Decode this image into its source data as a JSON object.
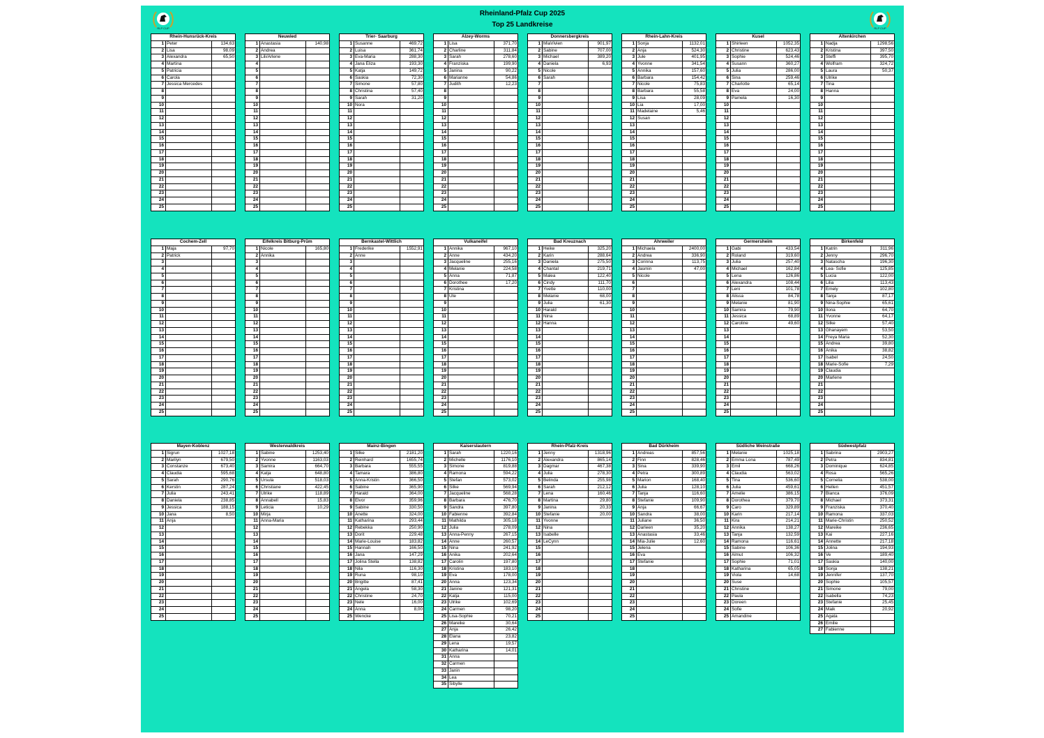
{
  "title": "Rheinland-Pfalz Cup 2025",
  "subtitle": "Top 25 Landkreise",
  "logo_text": "RLP CUP",
  "boards": [
    {
      "name": "Rhein-Hunsrück-Kreis",
      "rows": 25,
      "entries": [
        [
          "Peter",
          "134,63"
        ],
        [
          "Lisa",
          "98,09"
        ],
        [
          "Alexandra",
          "65,50"
        ],
        [
          "Martina",
          ""
        ],
        [
          "Patricia",
          ""
        ],
        [
          "Carola",
          ""
        ],
        [
          "Jessica Mercedes",
          ""
        ]
      ]
    },
    {
      "name": "Neuwied",
      "rows": 25,
      "entries": [
        [
          "Anastasia",
          "140,98"
        ],
        [
          "Andrea",
          ""
        ],
        [
          "Lili/Arlene",
          ""
        ]
      ]
    },
    {
      "name": "Trier- Saarburg",
      "rows": 25,
      "entries": [
        [
          "Susanne",
          "469,72"
        ],
        [
          "Luisa",
          "361,74"
        ],
        [
          "Eva-Maria",
          "288,30"
        ],
        [
          "Jana Eliza",
          "193,30"
        ],
        [
          "Katja",
          "149,72"
        ],
        [
          "Saskia",
          "72,30"
        ],
        [
          "Simone",
          "57,80"
        ],
        [
          "Christina",
          "57,40"
        ],
        [
          "Sarah",
          "31,20"
        ],
        [
          "Nora",
          ""
        ]
      ]
    },
    {
      "name": "Alzey-Worms",
      "rows": 25,
      "entries": [
        [
          "Lisa",
          "371,70"
        ],
        [
          "Charline",
          "311,84"
        ],
        [
          "Sarah",
          "278,60"
        ],
        [
          "Franziska",
          "199,90"
        ],
        [
          "Janina",
          "90,22"
        ],
        [
          "Marianne",
          "54,86"
        ],
        [
          "Judith",
          "12,23"
        ]
      ]
    },
    {
      "name": "Donnersbergkreis",
      "rows": 25,
      "entries": [
        [
          "MiaVivien",
          "901,97"
        ],
        [
          "Sabine",
          "707,00"
        ],
        [
          "Michael",
          "389,20"
        ],
        [
          "Daniela",
          "6,93"
        ],
        [
          "Nicole",
          ""
        ],
        [
          "Sarah",
          ""
        ]
      ]
    },
    {
      "name": "Rhein-Lahn-Kreis",
      "rows": 25,
      "entries": [
        [
          "Sonja",
          "1132,01"
        ],
        [
          "Anja",
          "524,30"
        ],
        [
          "Jule",
          "401,95"
        ],
        [
          "Yvonne",
          "341,54"
        ],
        [
          "Annika",
          "157,60"
        ],
        [
          "Barbara",
          "154,42"
        ],
        [
          "Nicole",
          "75,83"
        ],
        [
          "Barbara",
          "55,58"
        ],
        [
          "Lisa",
          "28,09"
        ],
        [
          "Lia",
          "17,00"
        ],
        [
          "Madelaine",
          "5,46"
        ],
        [
          "Susan",
          ""
        ]
      ]
    },
    {
      "name": "Kusel",
      "rows": 25,
      "entries": [
        [
          "Shirleen",
          "1052,35"
        ],
        [
          "Christine",
          "623,43"
        ],
        [
          "Sophie",
          "524,46"
        ],
        [
          "Susann",
          "360,27"
        ],
        [
          "Julia",
          "286,00"
        ],
        [
          "Sina",
          "259,46"
        ],
        [
          "Charlotte",
          "65,14"
        ],
        [
          "Eva",
          "24,00"
        ],
        [
          "Pamela",
          "16,30"
        ]
      ]
    },
    {
      "name": "Altenkirchen",
      "rows": 25,
      "entries": [
        [
          "Nadja",
          "1298,56"
        ],
        [
          "Kristina",
          "397,50"
        ],
        [
          "Steffi",
          "395,70"
        ],
        [
          "Wolfram",
          "324,72"
        ],
        [
          "Laura",
          "50,37"
        ],
        [
          "Ulrike",
          ""
        ],
        [
          "Tina",
          ""
        ],
        [
          "Hanna",
          ""
        ]
      ]
    },
    {
      "name": "Cochem-Zell",
      "rows": 25,
      "entries": [
        [
          "Maja",
          "97,70"
        ],
        [
          "Patrick",
          ""
        ]
      ]
    },
    {
      "name": "Eifelkreis Bitburg-Prüm",
      "rows": 25,
      "entries": [
        [
          "Nicole",
          "165,80"
        ],
        [
          "Annika",
          ""
        ]
      ]
    },
    {
      "name": "Bernkastel-Wittlich",
      "rows": 25,
      "entries": [
        [
          "Frederike",
          "1552,91"
        ],
        [
          "Anne",
          ""
        ]
      ]
    },
    {
      "name": "Vulkaneifel",
      "rows": 25,
      "entries": [
        [
          "Annika",
          "967,10"
        ],
        [
          "Anne",
          "434,20"
        ],
        [
          "Jacqueline",
          "255,16"
        ],
        [
          "Melanie",
          "224,58"
        ],
        [
          "Anna",
          "71,87"
        ],
        [
          "Dorothee",
          "17,20"
        ],
        [
          "Kristina",
          ""
        ],
        [
          "Ute",
          ""
        ]
      ]
    },
    {
      "name": "Bad Kreuznach",
      "rows": 25,
      "entries": [
        [
          "Heike",
          "325,20"
        ],
        [
          "Karin",
          "288,64"
        ],
        [
          "Daniela",
          "275,50"
        ],
        [
          "Chantal",
          "219,71"
        ],
        [
          "Malea",
          "122,40"
        ],
        [
          "Cindy",
          "111,70"
        ],
        [
          "Yvette",
          "110,00"
        ],
        [
          "Melanie",
          "68,00"
        ],
        [
          "Julia",
          "61,30"
        ],
        [
          "Harald",
          ""
        ],
        [
          "Nina",
          ""
        ],
        [
          "Hanna",
          ""
        ]
      ]
    },
    {
      "name": "Ahrweiler",
      "rows": 25,
      "entries": [
        [
          "Michaela",
          "2400,00"
        ],
        [
          "Andrea",
          "336,90"
        ],
        [
          "Corinna",
          "113,75"
        ],
        [
          "Jasmin",
          "47,00"
        ],
        [
          "Nicole",
          ""
        ]
      ]
    },
    {
      "name": "Germersheim",
      "rows": 25,
      "entries": [
        [
          "Gabi",
          "433,54"
        ],
        [
          "Roland",
          "319,60"
        ],
        [
          "Julia",
          "257,40"
        ],
        [
          "Michael",
          "162,84"
        ],
        [
          "Lena",
          "126,86"
        ],
        [
          "Alexandra",
          "108,44"
        ],
        [
          "Leni",
          "101,78"
        ],
        [
          "Alissa",
          "84,78"
        ],
        [
          "Melanie",
          "81,90"
        ],
        [
          "Samira",
          "79,90"
        ],
        [
          "Jessica",
          "68,89"
        ],
        [
          "Caroline",
          "49,60"
        ]
      ]
    },
    {
      "name": "Birkenfeld",
      "rows": 25,
      "entries": [
        [
          "Katrin",
          "311,96"
        ],
        [
          "Jenny",
          "296,70"
        ],
        [
          "Natascha",
          "196,30"
        ],
        [
          "Lea- Sofie",
          "125,85"
        ],
        [
          "Lucia",
          "122,00"
        ],
        [
          "Lilia",
          "113,43"
        ],
        [
          "Emely",
          "102,80"
        ],
        [
          "Tanja",
          "87,17"
        ],
        [
          "Nina-Sophie",
          "65,61"
        ],
        [
          "Ilona",
          "64,70"
        ],
        [
          "Yvonne",
          "64,17"
        ],
        [
          "Silke",
          "57,40"
        ],
        [
          "Ghanayem",
          "53,50"
        ],
        [
          "Freya Maria",
          "52,30"
        ],
        [
          "Andrea",
          "39,80"
        ],
        [
          "Anika",
          "38,82"
        ],
        [
          "Isabel",
          "24,50"
        ],
        [
          "Marie-Sofie",
          "7,29"
        ],
        [
          "Claudia",
          ""
        ],
        [
          "Marlene",
          ""
        ]
      ]
    },
    {
      "name": "Mayen-Koblenz",
      "rows": 25,
      "entries": [
        [
          "Sigrun",
          "1027,18"
        ],
        [
          "Marilyn",
          "679,50"
        ],
        [
          "Constanze",
          "673,40"
        ],
        [
          "Claudia",
          "595,68"
        ],
        [
          "Sarah",
          "290,76"
        ],
        [
          "Kerstin",
          "287,24"
        ],
        [
          "Julia",
          "243,41"
        ],
        [
          "Daniela",
          "238,85"
        ],
        [
          "Jessica",
          "188,15"
        ],
        [
          "Jana",
          "8,50"
        ],
        [
          "Anja",
          ""
        ]
      ]
    },
    {
      "name": "Westerwaldkreis",
      "rows": 25,
      "entries": [
        [
          "Sabine",
          "1253,40"
        ],
        [
          "Yvonne",
          "1163,03"
        ],
        [
          "Samira",
          "664,70"
        ],
        [
          "Katja",
          "648,80"
        ],
        [
          "Ursula",
          "518,03"
        ],
        [
          "Christiane",
          "422,45"
        ],
        [
          "Ulrike",
          "118,89"
        ],
        [
          "Annabell",
          "15,83"
        ],
        [
          "Leticia",
          "10,29"
        ],
        [
          "Mirja",
          ""
        ],
        [
          "Anna-Maria",
          ""
        ]
      ]
    },
    {
      "name": "Mainz-Bingen",
      "rows": 25,
      "entries": [
        [
          "Silke",
          "2181,20"
        ],
        [
          "Reinhard",
          "1655,74"
        ],
        [
          "Barbara",
          "555,55"
        ],
        [
          "Tamara",
          "386,80"
        ],
        [
          "Anna-Kristin",
          "366,50"
        ],
        [
          "Sabine",
          "365,90"
        ],
        [
          "Harald",
          "364,00"
        ],
        [
          "Elvor",
          "359,96"
        ],
        [
          "Sabine",
          "330,50"
        ],
        [
          "Anette",
          "324,00"
        ],
        [
          "Katharina",
          "293,44"
        ],
        [
          "Rebekka",
          "250,90"
        ],
        [
          "Dorit",
          "229,48"
        ],
        [
          "Marie-Louise",
          "183,82"
        ],
        [
          "Hannah",
          "166,50"
        ],
        [
          "Jana",
          "147,29"
        ],
        [
          "Jolina Stella",
          "138,82"
        ],
        [
          "Nila",
          "116,30"
        ],
        [
          "Runa",
          "98,10"
        ],
        [
          "Brigitte",
          "87,41"
        ],
        [
          "Angela",
          "58,30"
        ],
        [
          "Christine",
          "24,70"
        ],
        [
          "Nele",
          "16,00"
        ],
        [
          "Anna",
          "8,00"
        ],
        [
          "Wencke",
          ""
        ]
      ]
    },
    {
      "name": "Kaiserslautern",
      "rows": 35,
      "entries": [
        [
          "Sarah",
          "1220,16"
        ],
        [
          "Michelle",
          "1176,10"
        ],
        [
          "Simone",
          "819,88"
        ],
        [
          "Ramona",
          "594,22"
        ],
        [
          "Stefan",
          "573,02"
        ],
        [
          "Silke",
          "569,94"
        ],
        [
          "Jacqueline",
          "568,28"
        ],
        [
          "Barbara",
          "476,70"
        ],
        [
          "Sandra",
          "397,80"
        ],
        [
          "Fabienne",
          "392,84"
        ],
        [
          "Mathilda",
          "305,18"
        ],
        [
          "Julia",
          "278,09"
        ],
        [
          "Anna-Penny",
          "267,15"
        ],
        [
          "Anne",
          "260,57"
        ],
        [
          "Nina",
          "241,92"
        ],
        [
          "Anika",
          "202,64"
        ],
        [
          "Carolin",
          "197,80"
        ],
        [
          "Kristina",
          "183,10"
        ],
        [
          "Eva",
          "178,00"
        ],
        [
          "Anna",
          "123,34"
        ],
        [
          "Janine",
          "121,31"
        ],
        [
          "Katja",
          "115,00"
        ],
        [
          "Ulrike",
          "102,69"
        ],
        [
          "Carmen",
          "98,20"
        ],
        [
          "Lisa-Sophie",
          "70,21"
        ],
        [
          "Mareike",
          "30,64"
        ],
        [
          "Anja",
          "26,42"
        ],
        [
          "Elana",
          "23,82"
        ],
        [
          "Lena",
          "19,57"
        ],
        [
          "Katharina",
          "14,01"
        ],
        [
          "Anna",
          ""
        ],
        [
          "Carmen",
          ""
        ],
        [
          "Janin",
          ""
        ],
        [
          "Lea",
          ""
        ],
        [
          "Sibylle",
          ""
        ]
      ]
    },
    {
      "name": "Rhein-Pfalz-Kreis",
      "rows": 25,
      "entries": [
        [
          "Jenny",
          "1318,96"
        ],
        [
          "Alexandra",
          "865,14"
        ],
        [
          "Dagmar",
          "467,38"
        ],
        [
          "Julia",
          "278,30"
        ],
        [
          "Belinda",
          "255,98"
        ],
        [
          "Sarah",
          "212,12"
        ],
        [
          "Lena",
          "160,46"
        ],
        [
          "Martina",
          "29,80"
        ],
        [
          "Janina",
          "20,33"
        ],
        [
          "Stefanie",
          "20,00"
        ],
        [
          "Yvonne",
          ""
        ],
        [
          "Nina",
          ""
        ],
        [
          "Isabelle",
          ""
        ],
        [
          "LeCynn",
          ""
        ]
      ]
    },
    {
      "name": "Bad Dürkheim",
      "rows": 25,
      "entries": [
        [
          "Andreas",
          "857,56"
        ],
        [
          "Finn",
          "828,46"
        ],
        [
          "Sina",
          "339,90"
        ],
        [
          "Petra",
          "300,89"
        ],
        [
          "Marion",
          "168,40"
        ],
        [
          "Julia",
          "128,10"
        ],
        [
          "Tanja",
          "116,60"
        ],
        [
          "Stefanie",
          "109,90"
        ],
        [
          "Anja",
          "66,67"
        ],
        [
          "Sandra",
          "38,00"
        ],
        [
          "Juliane",
          "36,50"
        ],
        [
          "Darleen",
          "35,20"
        ],
        [
          "Anastasia",
          "33,46"
        ],
        [
          "Mia-Julie",
          "12,60"
        ],
        [
          "Jelena",
          ""
        ],
        [
          "Eva",
          ""
        ],
        [
          "Stefanie",
          ""
        ]
      ]
    },
    {
      "name": "Südliche Weinstraße",
      "rows": 25,
      "entries": [
        [
          "Melanie",
          "1025,18"
        ],
        [
          "Emma Lona",
          "787,49"
        ],
        [
          "Emil",
          "668,26"
        ],
        [
          "Claudia",
          "563,02"
        ],
        [
          "Tina",
          "536,60"
        ],
        [
          "Julia",
          "459,61"
        ],
        [
          "Amelie",
          "386,15"
        ],
        [
          "Dorothea",
          "379,70"
        ],
        [
          "Caro",
          "329,89"
        ],
        [
          "Karin",
          "217,14"
        ],
        [
          "Kira",
          "214,21"
        ],
        [
          "Annika",
          "138,27"
        ],
        [
          "Tanja",
          "132,59"
        ],
        [
          "Ramona",
          "116,61"
        ],
        [
          "Sabine",
          "106,36"
        ],
        [
          "Almut",
          "106,32"
        ],
        [
          "Sophie",
          "71,01"
        ],
        [
          "Katharina",
          "65,05"
        ],
        [
          "Viola",
          "14,68"
        ],
        [
          "Suse",
          ""
        ],
        [
          "Christine",
          ""
        ],
        [
          "Paula",
          ""
        ],
        [
          "Doreen",
          ""
        ],
        [
          "Sofie",
          ""
        ],
        [
          "Amandine",
          ""
        ]
      ]
    },
    {
      "name": "Südwestpfalz",
      "rows": 27,
      "entries": [
        [
          "Sabrina",
          "2903,27"
        ],
        [
          "Petra",
          "834,81"
        ],
        [
          "Dominique",
          "624,85"
        ],
        [
          "Rosa",
          "565,26"
        ],
        [
          "Cornelia",
          "538,00"
        ],
        [
          "Hellen",
          "451,57"
        ],
        [
          "Bianca",
          "376,09"
        ],
        [
          "Michael",
          "373,31"
        ],
        [
          "Franziska",
          "370,40"
        ],
        [
          "Ramona",
          "337,03"
        ],
        [
          "Marie-Christin",
          "250,52"
        ],
        [
          "Mareike",
          "236,65"
        ],
        [
          "Kai",
          "227,16"
        ],
        [
          "Annette",
          "217,18"
        ],
        [
          "Jolina",
          "194,93"
        ],
        [
          "Ve",
          "189,40"
        ],
        [
          "Saskia",
          "140,00"
        ],
        [
          "Sonja",
          "138,21"
        ],
        [
          "Jennifer",
          "137,70"
        ],
        [
          "Sophie",
          "105,57"
        ],
        [
          "Simone",
          "79,00"
        ],
        [
          "Isabella",
          "74,23"
        ],
        [
          "Stefanie",
          "25,45"
        ],
        [
          "Maik",
          "20,92"
        ],
        [
          "Agata",
          ""
        ],
        [
          "Emilie",
          ""
        ],
        [
          "Fabienne",
          ""
        ]
      ]
    }
  ]
}
